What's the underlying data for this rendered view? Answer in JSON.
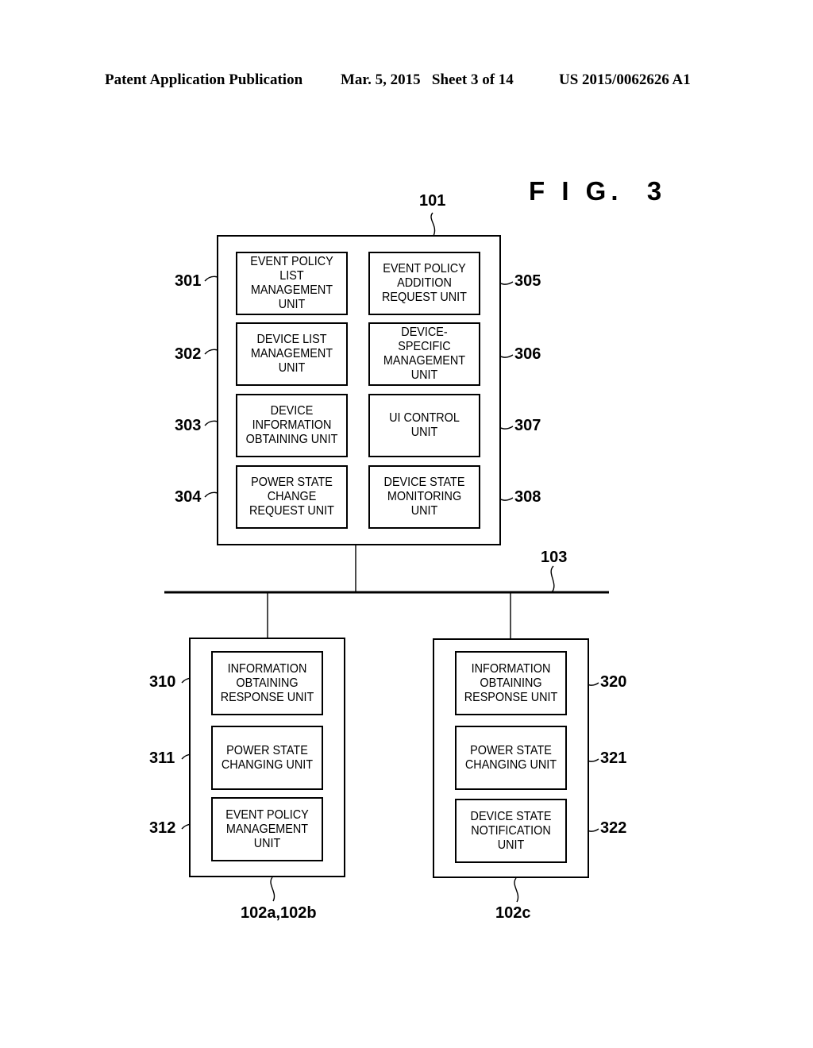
{
  "header": {
    "publication": "Patent Application Publication",
    "date_sheet": "Mar. 5, 2015   Sheet 3 of 14",
    "patent_number": "US 2015/0062626 A1"
  },
  "figure_label": "F I G.  3",
  "server": {
    "ref": "101",
    "units": [
      {
        "ref": "301",
        "label": "EVENT POLICY LIST MANAGEMENT UNIT"
      },
      {
        "ref": "302",
        "label": "DEVICE LIST MANAGEMENT UNIT"
      },
      {
        "ref": "303",
        "label": "DEVICE INFORMATION OBTAINING UNIT"
      },
      {
        "ref": "304",
        "label": "POWER STATE CHANGE REQUEST UNIT"
      },
      {
        "ref": "305",
        "label": "EVENT POLICY ADDITION REQUEST UNIT"
      },
      {
        "ref": "306",
        "label": "DEVICE-SPECIFIC MANAGEMENT UNIT"
      },
      {
        "ref": "307",
        "label": "UI CONTROL UNIT"
      },
      {
        "ref": "308",
        "label": "DEVICE STATE MONITORING UNIT"
      }
    ]
  },
  "network": {
    "ref": "103"
  },
  "device_ab": {
    "ref": "102a,102b",
    "units": [
      {
        "ref": "310",
        "label": "INFORMATION OBTAINING RESPONSE UNIT"
      },
      {
        "ref": "311",
        "label": "POWER STATE CHANGING UNIT"
      },
      {
        "ref": "312",
        "label": "EVENT POLICY MANAGEMENT UNIT"
      }
    ]
  },
  "device_c": {
    "ref": "102c",
    "units": [
      {
        "ref": "320",
        "label": "INFORMATION OBTAINING RESPONSE UNIT"
      },
      {
        "ref": "321",
        "label": "POWER STATE CHANGING UNIT"
      },
      {
        "ref": "322",
        "label": "DEVICE STATE NOTIFICATION UNIT"
      }
    ]
  }
}
